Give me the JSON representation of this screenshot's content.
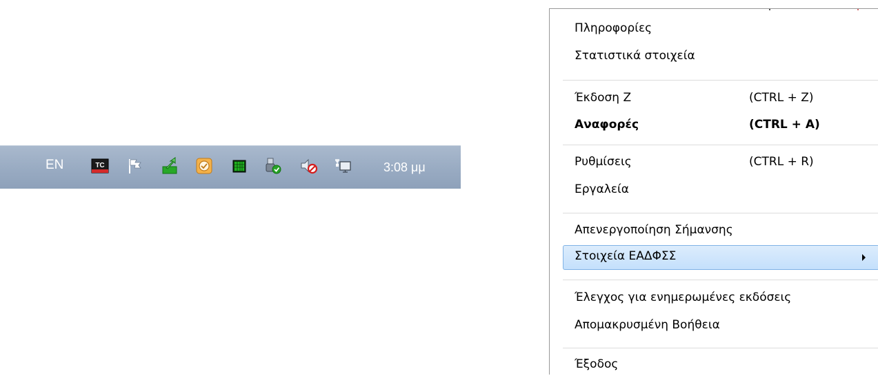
{
  "taskbar": {
    "language": "EN",
    "clock": "3:08 μμ",
    "tray_icons": [
      {
        "name": "tc-icon",
        "label": "TC"
      },
      {
        "name": "flag-icon"
      },
      {
        "name": "green-arrow-icon"
      },
      {
        "name": "orange-clock-icon"
      },
      {
        "name": "green-grid-icon"
      },
      {
        "name": "usb-device-check-icon"
      },
      {
        "name": "speaker-muted-icon"
      },
      {
        "name": "network-icon"
      }
    ]
  },
  "menu": {
    "items": [
      {
        "label": "Πληροφορίες",
        "shortcut": ""
      },
      {
        "label": "Στατιστικά στοιχεία",
        "shortcut": ""
      },
      {
        "label": "Έκδοση Ζ",
        "shortcut": "(CTRL + Z)"
      },
      {
        "label": "Αναφορές",
        "shortcut": "(CTRL + A)"
      },
      {
        "label": "Ρυθμίσεις",
        "shortcut": "(CTRL + R)"
      },
      {
        "label": "Εργαλεία",
        "shortcut": ""
      },
      {
        "label": "Απενεργοποίηση Σήμανσης",
        "shortcut": ""
      },
      {
        "label": "Στοιχεία ΕΑΔΦΣΣ",
        "shortcut": ""
      },
      {
        "label": "Έλεγχος για ενημερωμένες εκδόσεις",
        "shortcut": ""
      },
      {
        "label": "Απομακρυσμένη Βοήθεια",
        "shortcut": ""
      },
      {
        "label": "Έξοδος",
        "shortcut": ""
      }
    ],
    "highlight_color": "#cce4fc"
  }
}
